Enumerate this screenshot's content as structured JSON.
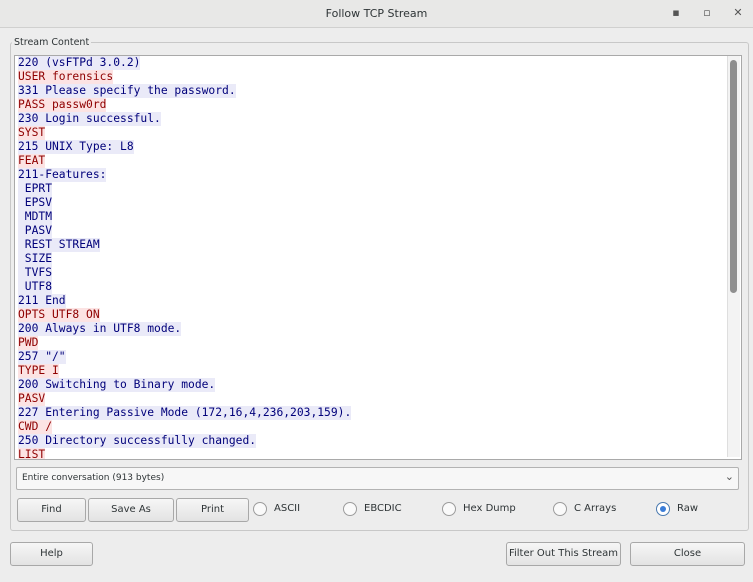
{
  "window": {
    "title": "Follow TCP Stream",
    "minimize": "▪",
    "maximize": "▫",
    "close": "✕"
  },
  "frame": {
    "label": "Stream Content"
  },
  "stream": {
    "lines": [
      {
        "dir": "server",
        "text": "220 (vsFTPd 3.0.2)"
      },
      {
        "dir": "client",
        "text": "USER forensics"
      },
      {
        "dir": "server",
        "text": "331 Please specify the password."
      },
      {
        "dir": "client",
        "text": "PASS passw0rd"
      },
      {
        "dir": "server",
        "text": "230 Login successful."
      },
      {
        "dir": "client",
        "text": "SYST"
      },
      {
        "dir": "server",
        "text": "215 UNIX Type: L8"
      },
      {
        "dir": "client",
        "text": "FEAT"
      },
      {
        "dir": "server",
        "text": "211-Features:"
      },
      {
        "dir": "server",
        "text": " EPRT"
      },
      {
        "dir": "server",
        "text": " EPSV"
      },
      {
        "dir": "server",
        "text": " MDTM"
      },
      {
        "dir": "server",
        "text": " PASV"
      },
      {
        "dir": "server",
        "text": " REST STREAM"
      },
      {
        "dir": "server",
        "text": " SIZE"
      },
      {
        "dir": "server",
        "text": " TVFS"
      },
      {
        "dir": "server",
        "text": " UTF8"
      },
      {
        "dir": "server",
        "text": "211 End"
      },
      {
        "dir": "client",
        "text": "OPTS UTF8 ON"
      },
      {
        "dir": "server",
        "text": "200 Always in UTF8 mode."
      },
      {
        "dir": "client",
        "text": "PWD"
      },
      {
        "dir": "server",
        "text": "257 \"/\""
      },
      {
        "dir": "client",
        "text": "TYPE I"
      },
      {
        "dir": "server",
        "text": "200 Switching to Binary mode."
      },
      {
        "dir": "client",
        "text": "PASV"
      },
      {
        "dir": "server",
        "text": "227 Entering Passive Mode (172,16,4,236,203,159)."
      },
      {
        "dir": "client",
        "text": "CWD /"
      },
      {
        "dir": "server",
        "text": "250 Directory successfully changed."
      },
      {
        "dir": "client",
        "text": "LIST"
      }
    ]
  },
  "conversation_select": {
    "value": "Entire conversation (913 bytes)"
  },
  "toolbar": {
    "find": "Find",
    "save_as": "Save As",
    "print": "Print"
  },
  "format_options": {
    "ascii": "ASCII",
    "ebcdic": "EBCDIC",
    "hex_dump": "Hex Dump",
    "c_arrays": "C Arrays",
    "raw": "Raw",
    "selected": "Raw"
  },
  "footer": {
    "help": "Help",
    "filter_out": "Filter Out This Stream",
    "close": "Close"
  },
  "colors": {
    "client_fg": "#8f0000",
    "client_bg": "#fce3e3",
    "server_fg": "#00007a",
    "server_bg": "#eaeaf8"
  }
}
